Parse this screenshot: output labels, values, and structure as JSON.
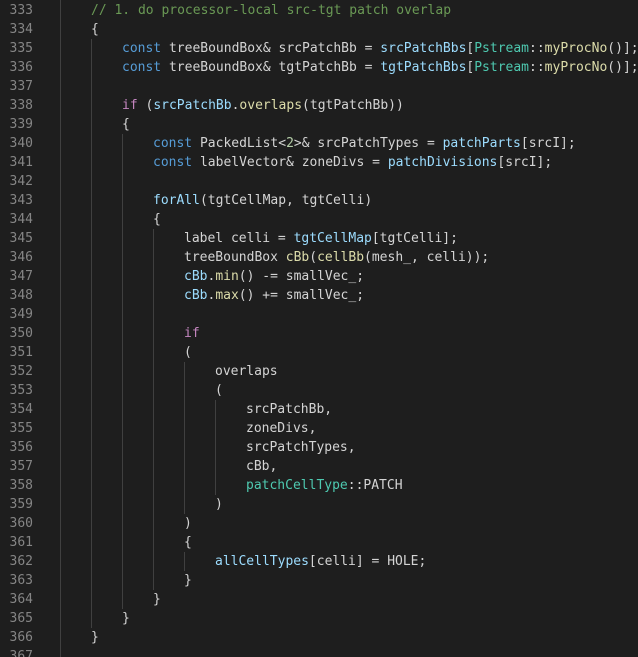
{
  "editor": {
    "language": "cpp",
    "theme_colors": {
      "background": "#1e1e1e",
      "line_number": "#858585",
      "default_text": "#d4d4d4",
      "keyword": "#569cd6",
      "control": "#c586c0",
      "comment": "#6a9955",
      "type": "#4ec9b0",
      "variable": "#9cdcfe",
      "function": "#dcdcaa",
      "number": "#b5cea8",
      "indent_guide": "#404040"
    },
    "lines": [
      {
        "n": "333",
        "indent": 1,
        "tokens": [
          [
            "comment",
            "// 1. do processor-local src-tgt patch overlap"
          ]
        ]
      },
      {
        "n": "334",
        "indent": 1,
        "tokens": [
          [
            "plain",
            "{"
          ]
        ]
      },
      {
        "n": "335",
        "indent": 2,
        "tokens": [
          [
            "kw",
            "const"
          ],
          [
            "plain",
            " treeBoundBox& srcPatchBb = "
          ],
          [
            "var",
            "srcPatchBbs"
          ],
          [
            "plain",
            "["
          ],
          [
            "type",
            "Pstream"
          ],
          [
            "plain",
            "::"
          ],
          [
            "func",
            "myProcNo"
          ],
          [
            "plain",
            "()];"
          ]
        ]
      },
      {
        "n": "336",
        "indent": 2,
        "tokens": [
          [
            "kw",
            "const"
          ],
          [
            "plain",
            " treeBoundBox& tgtPatchBb = "
          ],
          [
            "var",
            "tgtPatchBbs"
          ],
          [
            "plain",
            "["
          ],
          [
            "type",
            "Pstream"
          ],
          [
            "plain",
            "::"
          ],
          [
            "func",
            "myProcNo"
          ],
          [
            "plain",
            "()];"
          ]
        ]
      },
      {
        "n": "337",
        "indent": 2,
        "tokens": []
      },
      {
        "n": "338",
        "indent": 2,
        "tokens": [
          [
            "ctrl",
            "if"
          ],
          [
            "plain",
            " ("
          ],
          [
            "var",
            "srcPatchBb"
          ],
          [
            "plain",
            "."
          ],
          [
            "func",
            "overlaps"
          ],
          [
            "plain",
            "(tgtPatchBb))"
          ]
        ]
      },
      {
        "n": "339",
        "indent": 2,
        "tokens": [
          [
            "plain",
            "{"
          ]
        ]
      },
      {
        "n": "340",
        "indent": 3,
        "tokens": [
          [
            "kw",
            "const"
          ],
          [
            "plain",
            " PackedList<"
          ],
          [
            "num",
            "2"
          ],
          [
            "plain",
            ">& srcPatchTypes = "
          ],
          [
            "var",
            "patchParts"
          ],
          [
            "plain",
            "[srcI];"
          ]
        ]
      },
      {
        "n": "341",
        "indent": 3,
        "tokens": [
          [
            "kw",
            "const"
          ],
          [
            "plain",
            " labelVector& zoneDivs = "
          ],
          [
            "var",
            "patchDivisions"
          ],
          [
            "plain",
            "[srcI];"
          ]
        ]
      },
      {
        "n": "342",
        "indent": 3,
        "tokens": []
      },
      {
        "n": "343",
        "indent": 3,
        "tokens": [
          [
            "var",
            "forAll"
          ],
          [
            "plain",
            "(tgtCellMap, tgtCelli)"
          ]
        ]
      },
      {
        "n": "344",
        "indent": 3,
        "tokens": [
          [
            "plain",
            "{"
          ]
        ]
      },
      {
        "n": "345",
        "indent": 4,
        "tokens": [
          [
            "plain",
            "label celli = "
          ],
          [
            "var",
            "tgtCellMap"
          ],
          [
            "plain",
            "[tgtCelli];"
          ]
        ]
      },
      {
        "n": "346",
        "indent": 4,
        "tokens": [
          [
            "plain",
            "treeBoundBox "
          ],
          [
            "func",
            "cBb"
          ],
          [
            "plain",
            "("
          ],
          [
            "func",
            "cellBb"
          ],
          [
            "plain",
            "(mesh_, celli));"
          ]
        ]
      },
      {
        "n": "347",
        "indent": 4,
        "tokens": [
          [
            "var",
            "cBb"
          ],
          [
            "plain",
            "."
          ],
          [
            "func",
            "min"
          ],
          [
            "plain",
            "() -= smallVec_;"
          ]
        ]
      },
      {
        "n": "348",
        "indent": 4,
        "tokens": [
          [
            "var",
            "cBb"
          ],
          [
            "plain",
            "."
          ],
          [
            "func",
            "max"
          ],
          [
            "plain",
            "() += smallVec_;"
          ]
        ]
      },
      {
        "n": "349",
        "indent": 4,
        "tokens": []
      },
      {
        "n": "350",
        "indent": 4,
        "tokens": [
          [
            "ctrl",
            "if"
          ]
        ]
      },
      {
        "n": "351",
        "indent": 4,
        "tokens": [
          [
            "plain",
            "("
          ]
        ]
      },
      {
        "n": "352",
        "indent": 5,
        "tokens": [
          [
            "plain",
            "overlaps"
          ]
        ]
      },
      {
        "n": "353",
        "indent": 5,
        "tokens": [
          [
            "plain",
            "("
          ]
        ]
      },
      {
        "n": "354",
        "indent": 6,
        "tokens": [
          [
            "plain",
            "srcPatchBb,"
          ]
        ]
      },
      {
        "n": "355",
        "indent": 6,
        "tokens": [
          [
            "plain",
            "zoneDivs,"
          ]
        ]
      },
      {
        "n": "356",
        "indent": 6,
        "tokens": [
          [
            "plain",
            "srcPatchTypes,"
          ]
        ]
      },
      {
        "n": "357",
        "indent": 6,
        "tokens": [
          [
            "plain",
            "cBb,"
          ]
        ]
      },
      {
        "n": "358",
        "indent": 6,
        "tokens": [
          [
            "type",
            "patchCellType"
          ],
          [
            "plain",
            "::PATCH"
          ]
        ]
      },
      {
        "n": "359",
        "indent": 5,
        "tokens": [
          [
            "plain",
            ")"
          ]
        ]
      },
      {
        "n": "360",
        "indent": 4,
        "tokens": [
          [
            "plain",
            ")"
          ]
        ]
      },
      {
        "n": "361",
        "indent": 4,
        "tokens": [
          [
            "plain",
            "{"
          ]
        ]
      },
      {
        "n": "362",
        "indent": 5,
        "tokens": [
          [
            "var",
            "allCellTypes"
          ],
          [
            "plain",
            "[celli] = HOLE;"
          ]
        ]
      },
      {
        "n": "363",
        "indent": 4,
        "tokens": [
          [
            "plain",
            "}"
          ]
        ]
      },
      {
        "n": "364",
        "indent": 3,
        "tokens": [
          [
            "plain",
            "}"
          ]
        ]
      },
      {
        "n": "365",
        "indent": 2,
        "tokens": [
          [
            "plain",
            "}"
          ]
        ]
      },
      {
        "n": "366",
        "indent": 1,
        "tokens": [
          [
            "plain",
            "}"
          ]
        ]
      },
      {
        "n": "367",
        "indent": 1,
        "tokens": []
      }
    ]
  }
}
